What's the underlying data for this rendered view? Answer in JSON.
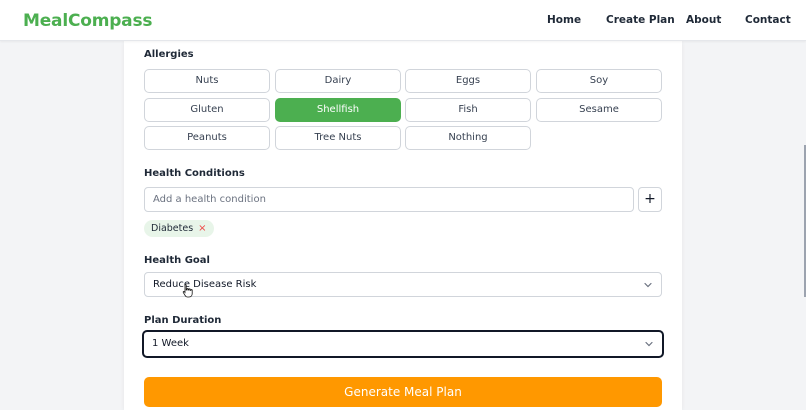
{
  "navbar": {
    "brand": "MealCompass",
    "links": [
      "Home",
      "Create Plan",
      "About",
      "Contact"
    ]
  },
  "allergies": {
    "label": "Allergies",
    "options": [
      "Nuts",
      "Dairy",
      "Eggs",
      "Soy",
      "Gluten",
      "Shellfish",
      "Fish",
      "Sesame",
      "Peanuts",
      "Tree Nuts",
      "Nothing"
    ],
    "selected": "Shellfish"
  },
  "health_conditions": {
    "label": "Health Conditions",
    "placeholder": "Add a health condition",
    "add_label": "+",
    "tags": [
      {
        "label": "Diabetes",
        "remove": "×"
      }
    ]
  },
  "health_goal": {
    "label": "Health Goal",
    "value": "Reduce Disease Risk"
  },
  "plan_duration": {
    "label": "Plan Duration",
    "value": "1 Week"
  },
  "generate_label": "Generate Meal Plan",
  "colors": {
    "brand": "#4caf50",
    "selected_option": "#4caf50",
    "generate_button": "#ff9800",
    "chip_bg": "#e8f5e9",
    "chip_remove": "#ef4444"
  }
}
